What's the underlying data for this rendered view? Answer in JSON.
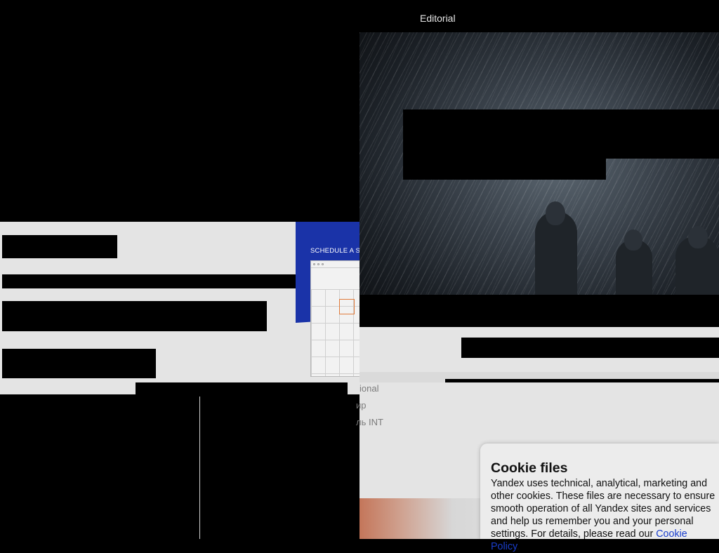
{
  "left_panel": {
    "schedule_label": "SCHEDULE A SE",
    "menu_items": [
      "ional",
      "ир",
      "ль INT"
    ]
  },
  "right_column": {
    "editorial_label": "Editorial"
  },
  "cookie_dialog": {
    "title": "Cookie files",
    "body": "Yandex uses technical, analytical, marketing and other cookies. These files are necessary to ensure smooth operation of all Yandex sites and services and help us remember you and your personal settings. For details, please read our ",
    "link_label": "Cookie Policy",
    "trailing": "."
  },
  "colors": {
    "accent_blue": "#1a33a8",
    "link_blue": "#1a3ecc",
    "calendar_highlight": "#e07a3a"
  }
}
